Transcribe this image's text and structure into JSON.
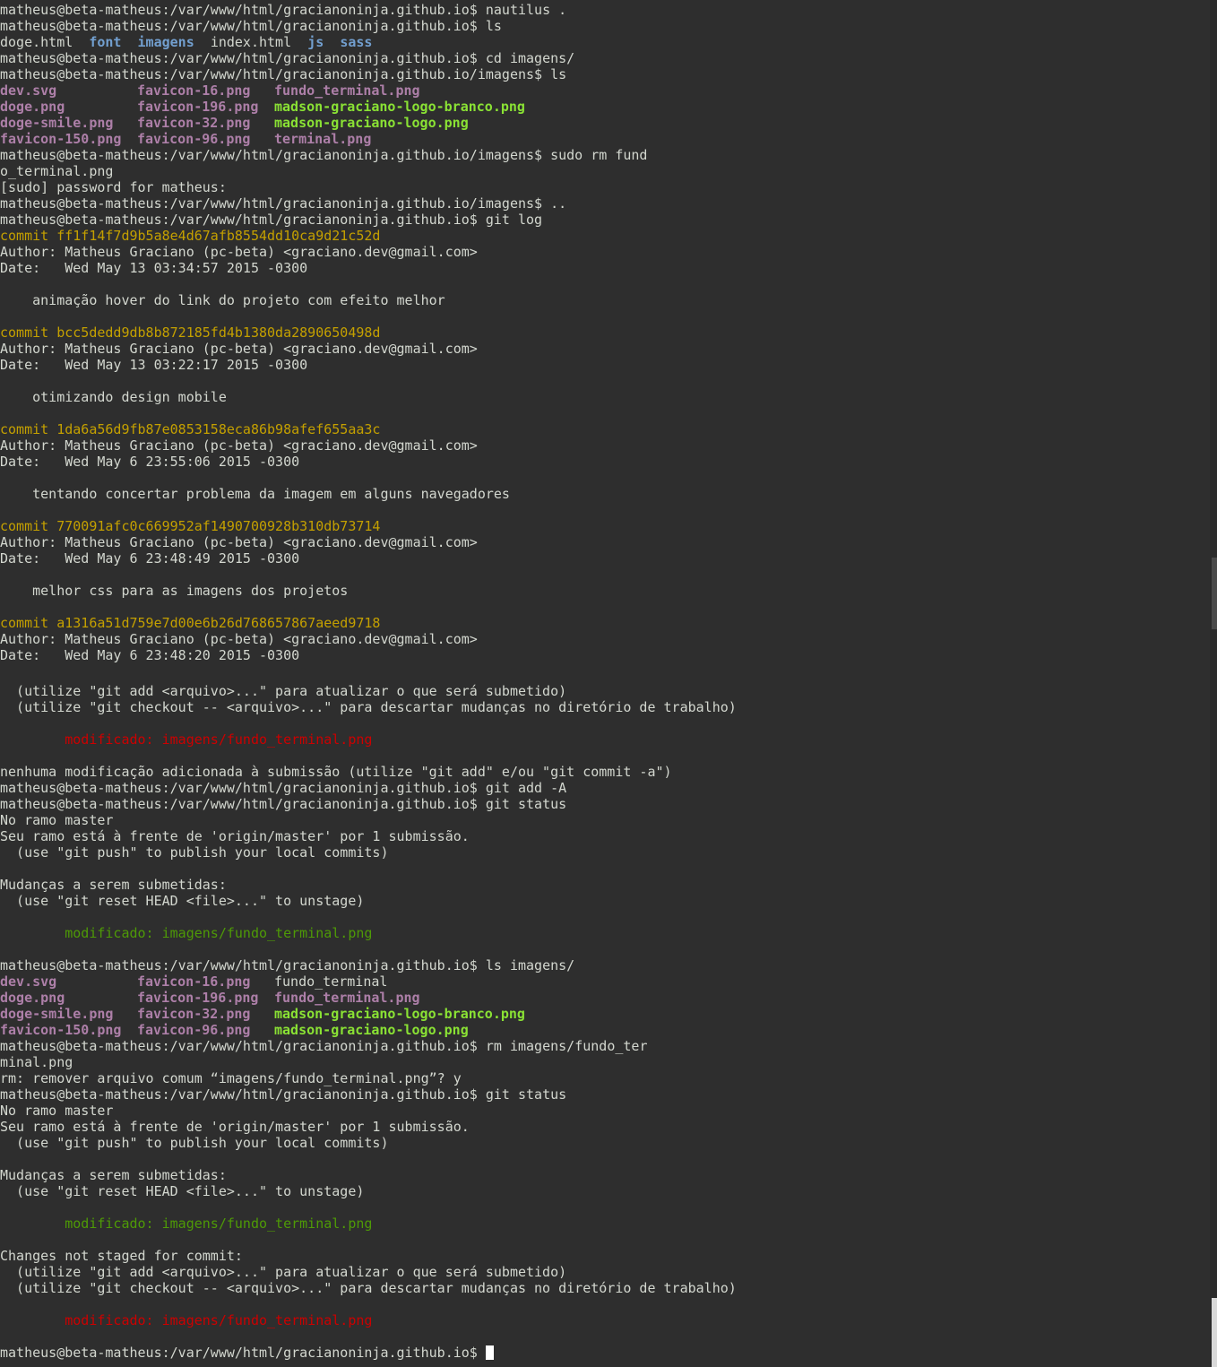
{
  "prompt": "matheus@beta-matheus:/var/www/html/gracianoninja.github.io$",
  "prompt_imagens": "matheus@beta-matheus:/var/www/html/gracianoninja.github.io/imagens$",
  "cmd": {
    "nautilus": " nautilus .",
    "ls": " ls",
    "cd_imagens": " cd imagens/",
    "sudo_rm": " sudo rm fund",
    "sudo_rm_wrap": "o_terminal.png",
    "dotdot": " ..",
    "git_log": " git log",
    "git_add": " git add -A",
    "git_status": " git status",
    "ls_imagens": " ls imagens/",
    "rm": " rm imagens/fundo_ter",
    "rm_wrap": "minal.png"
  },
  "ls_root": [
    "doge.html",
    "font",
    "imagens",
    "index.html",
    "js",
    "sass"
  ],
  "ls_imagens_1": [
    [
      "dev.svg",
      "favicon-16.png",
      "fundo_terminal.png"
    ],
    [
      "doge.png",
      "favicon-196.png",
      "madson-graciano-logo-branco.png"
    ],
    [
      "doge-smile.png",
      "favicon-32.png",
      "madson-graciano-logo.png"
    ],
    [
      "favicon-150.png",
      "favicon-96.png",
      "terminal.png"
    ]
  ],
  "sudo_password": "[sudo] password for matheus:",
  "commits": [
    {
      "commit": "commit ff1f14f7d9b5a8e4d67afb8554dd10ca9d21c52d",
      "author": "Author: Matheus Graciano (pc-beta) <graciano.dev@gmail.com>",
      "date": "Date:   Wed May 13 03:34:57 2015 -0300",
      "message": "    animação hover do link do projeto com efeito melhor"
    },
    {
      "commit": "commit bcc5dedd9db8b872185fd4b1380da2890650498d",
      "author": "Author: Matheus Graciano (pc-beta) <graciano.dev@gmail.com>",
      "date": "Date:   Wed May 13 03:22:17 2015 -0300",
      "message": "    otimizando design mobile"
    },
    {
      "commit": "commit 1da6a56d9fb87e0853158eca86b98afef655aa3c",
      "author": "Author: Matheus Graciano (pc-beta) <graciano.dev@gmail.com>",
      "date": "Date:   Wed May 6 23:55:06 2015 -0300",
      "message": "    tentando concertar problema da imagem em alguns navegadores"
    },
    {
      "commit": "commit 770091afc0c669952af1490700928b310db73714",
      "author": "Author: Matheus Graciano (pc-beta) <graciano.dev@gmail.com>",
      "date": "Date:   Wed May 6 23:48:49 2015 -0300",
      "message": "    melhor css para as imagens dos projetos"
    },
    {
      "commit": "commit a1316a51d759e7d00e6b26d768657867aeed9718",
      "author": "Author: Matheus Graciano (pc-beta) <graciano.dev@gmail.com>",
      "date": "Date:   Wed May 6 23:48:20 2015 -0300"
    }
  ],
  "hint_add": "  (utilize \"git add <arquivo>...\" para atualizar o que será submetido)",
  "hint_checkout": "  (utilize \"git checkout -- <arquivo>...\" para descartar mudanças no diretório de trabalho)",
  "modified": "        modificado: imagens/fundo_terminal.png",
  "nothing_added": "nenhuma modificação adicionada à submissão (utilize \"git add\" e/ou \"git commit -a\")",
  "status": {
    "branch": "No ramo master",
    "ahead": "Seu ramo está à frente de 'origin/master' por 1 submissão.",
    "push_hint": "  (use \"git push\" to publish your local commits)",
    "to_commit": "Mudanças a serem submetidas:",
    "reset_hint": "  (use \"git reset HEAD <file>...\" to unstage)",
    "not_staged": "Changes not staged for commit:"
  },
  "ls_imagens_2": [
    [
      "dev.svg",
      "favicon-16.png",
      "fundo_terminal"
    ],
    [
      "doge.png",
      "favicon-196.png",
      "fundo_terminal.png"
    ],
    [
      "doge-smile.png",
      "favicon-32.png",
      "madson-graciano-logo-branco.png"
    ],
    [
      "favicon-150.png",
      "favicon-96.png",
      "madson-graciano-logo.png"
    ]
  ],
  "rm_confirm": "rm: remover arquivo comum “imagens/fundo_terminal.png”? y",
  "colors": {
    "background": "#2e2e2e",
    "text": "#d3d7cf",
    "image_file": "#ad7fa8",
    "executable": "#8ae234",
    "directory": "#729fcf",
    "commit_hash": "#c4a000",
    "unstaged": "#cc0000",
    "staged": "#4e9a06"
  }
}
